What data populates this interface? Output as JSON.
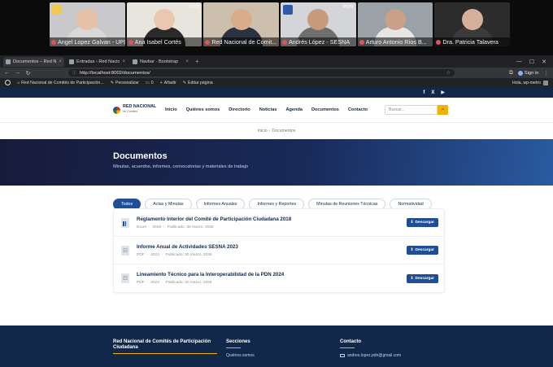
{
  "participants": [
    {
      "name": "Angel Lopez Galvan - UPD...",
      "brand": "",
      "badge": "yellow",
      "skin": "#e7c1a6",
      "shirt": "#d8d8d8",
      "bg": "#c9c9cc"
    },
    {
      "name": "Ana Isabel Cortés",
      "brand": "PDN",
      "badge": "",
      "skin": "#ecc7b0",
      "shirt": "#2a2a2a",
      "bg": "#e8e4de"
    },
    {
      "name": "Red Nacional de Comit...",
      "brand": "",
      "badge": "",
      "skin": "#d9ad8c",
      "shirt": "#2b3340",
      "bg": "#cdbfae",
      "active": true
    },
    {
      "name": "Andrés López - SESNA",
      "brand": "PDN",
      "badge": "blue",
      "skin": "#c79a7d",
      "shirt": "#6f6f6f",
      "bg": "#d3d5d8"
    },
    {
      "name": "Arturo Antonio Ríos B...",
      "brand": "",
      "badge": "",
      "skin": "#c9a088",
      "shirt": "#e6e6e6",
      "bg": "#9aa2a8"
    },
    {
      "name": "Dra. Patricia Talavera",
      "brand": "",
      "badge": "",
      "skin": "#d6b09a",
      "shirt": "#3b3b3b",
      "bg": "#2c2c2c"
    }
  ],
  "browser": {
    "tabs": [
      {
        "title": "Documentos – Red Nacio",
        "active": true
      },
      {
        "title": "Entradas ‹ Red Nacio",
        "active": false
      },
      {
        "title": "Navbar · Bootstrap",
        "active": false
      }
    ],
    "url": "http://localhost:8002/documentos/",
    "sign_in": "Sign in"
  },
  "wp_admin": {
    "site_name": "Red Nacional de Comités de Participación...",
    "customize": "Personalizar",
    "comments": "0",
    "add": "Añadir",
    "edit": "Editar página",
    "greeting": "Hola, wp-metro"
  },
  "site": {
    "social": [
      "f",
      "X",
      "▶"
    ],
    "logo_title": "RED NACIONAL",
    "logo_sub": "de Comités",
    "menu": [
      "Inicio",
      "Quiénes somos",
      "Directorio",
      "Noticias",
      "Agenda",
      "Documentos",
      "Contacto"
    ],
    "search_placeholder": "Buscar...",
    "breadcrumb": {
      "home": "Inicio",
      "sep": "›",
      "current": "Documentos"
    },
    "hero": {
      "title": "Documentos",
      "subtitle": "Minutas, acuerdos, informes, convocatorias y materiales de trabajo"
    },
    "filters": [
      "Todos",
      "Actas y Minutas",
      "Informes Anuales",
      "Informes y Reportes",
      "Minutas de Reuniones Técnicas",
      "Normatividad"
    ],
    "active_filter": 0,
    "documents": [
      {
        "title": "Reglamento Interior del Comité de Participación Ciudadana 2018",
        "format": "Excel",
        "year": "2018",
        "published": "Publicado: 30 marzo, 2026",
        "icon": "xl"
      },
      {
        "title": "Informe Anual de Actividades SESNA 2023",
        "format": "PDF",
        "year": "2023",
        "published": "Publicado: 30 marzo, 2026",
        "icon": "pdf"
      },
      {
        "title": "Lineamiento Técnico para la Interoperabilidad de la PDN 2024",
        "format": "PDF",
        "year": "2024",
        "published": "Publicado: 30 marzo, 2026",
        "icon": "pdf"
      }
    ],
    "download_label": "Descargar",
    "meta_sep": "·",
    "footer": {
      "org": "Red Nacional de Comités de Participación Ciudadana",
      "sections_title": "Secciones",
      "sections_first": "Quiénes somos",
      "contact_title": "Contacto",
      "email": "andres.lopez.pdn@gmail.com"
    }
  },
  "colors": {
    "navy": "#12284a",
    "accent": "#f0b400",
    "primary": "#1f4e96"
  }
}
